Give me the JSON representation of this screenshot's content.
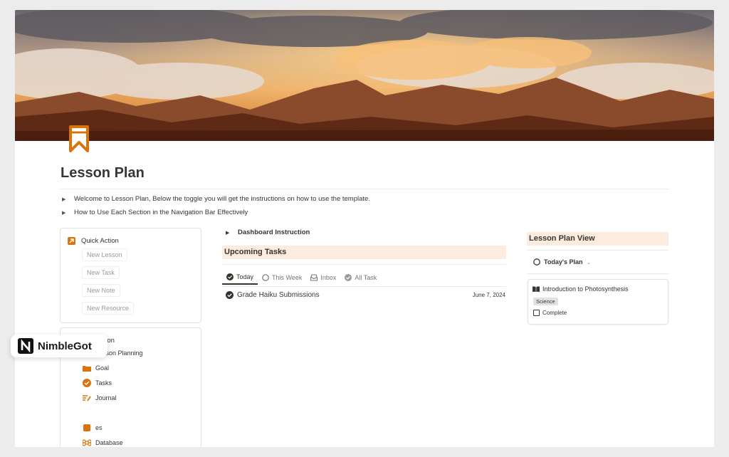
{
  "page": {
    "title": "Lesson Plan",
    "icon": "bookmark-icon",
    "accent": "#d9730d"
  },
  "toggles": [
    {
      "label": "Welcome to Lesson Plan, Below the toggle you will get the instructions on how to use the template."
    },
    {
      "label": "How to Use Each Section in the Navigation Bar Effectively"
    }
  ],
  "quick_action": {
    "title": "Quick Action",
    "buttons": [
      "New Lesson",
      "New Task",
      "New Note",
      "New Resource"
    ]
  },
  "navigation": {
    "title": "Navigation",
    "items": [
      {
        "label": "Lesson Planning",
        "icon": "book-open-icon"
      },
      {
        "label": "Goal",
        "icon": "folder-icon"
      },
      {
        "label": "Tasks",
        "icon": "check-circle-icon"
      },
      {
        "label": "Journal",
        "icon": "pen-lines-icon"
      },
      {
        "label": "es",
        "icon": "item-icon"
      },
      {
        "label": "Database",
        "icon": "command-icon"
      }
    ]
  },
  "dashboard": {
    "instruction_label": "Dashboard Instruction",
    "upcoming_title": "Upcoming Tasks",
    "tabs": [
      {
        "label": "Today",
        "active": true
      },
      {
        "label": "This Week",
        "active": false
      },
      {
        "label": "Inbox",
        "active": false
      },
      {
        "label": "All Task",
        "active": false
      }
    ],
    "tasks": [
      {
        "name": "Grade Haiku Submissions",
        "date": "June 7, 2024"
      }
    ]
  },
  "lesson_view": {
    "title": "Lesson Plan View",
    "view_label": "Today's Plan",
    "card": {
      "title": "Introduction to Photosynthesis",
      "tag": "Science",
      "checkbox_label": "Complete",
      "checked": false
    }
  },
  "watermark": {
    "brand": "NimbleGot"
  }
}
